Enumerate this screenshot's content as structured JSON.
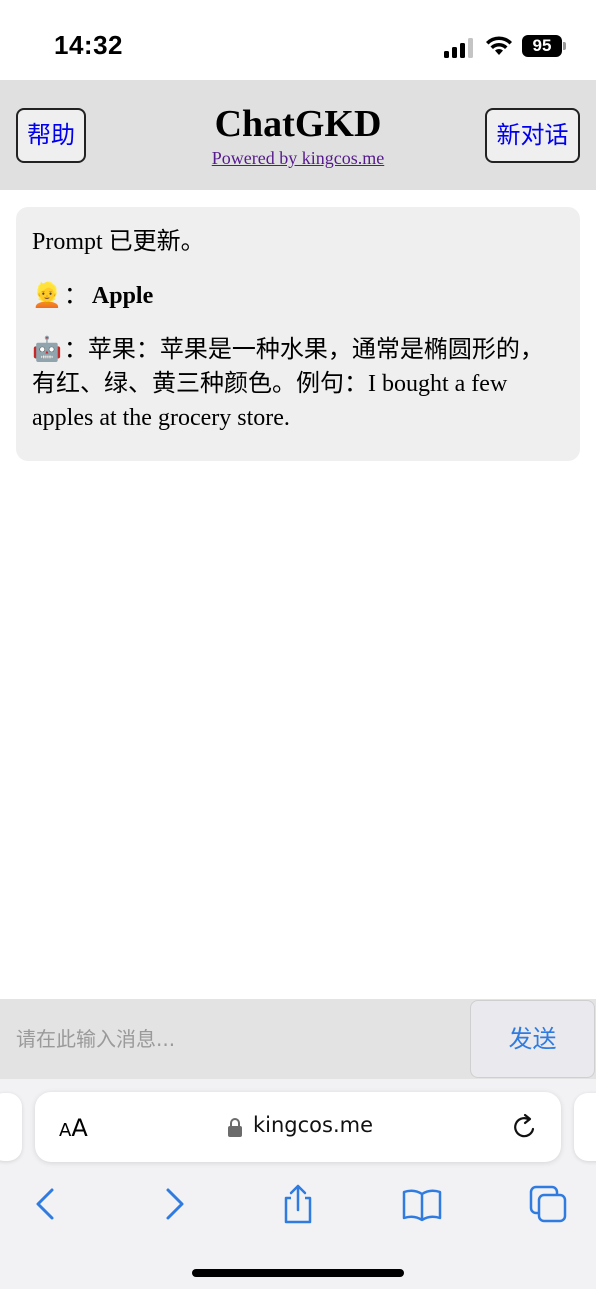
{
  "status_bar": {
    "time": "14:32",
    "battery_level": "95",
    "icons": [
      "signal-icon",
      "wifi-icon",
      "battery-icon"
    ]
  },
  "header": {
    "title": "ChatGKD",
    "powered_by": "Powered by kingcos.me",
    "help_label": "帮助",
    "new_chat_label": "新对话"
  },
  "chat": {
    "system_message": "Prompt 已更新。",
    "user_avatar": "👱",
    "user_message": "Apple",
    "bot_avatar": "🤖",
    "separator": "：",
    "bot_message": "苹果：苹果是一种水果，通常是椭圆形的，有红、绿、黄三种颜色。例句：I bought a few apples at the grocery store."
  },
  "input": {
    "placeholder": "请在此输入消息...",
    "value": "",
    "send_label": "发送"
  },
  "browser": {
    "aa_small": "A",
    "aa_big": "A",
    "url": "kingcos.me"
  },
  "colors": {
    "header_bg": "#e0e0e0",
    "card_bg": "#efefef",
    "link_blue": "#0000ee",
    "ios_blue": "#2f7be0"
  }
}
